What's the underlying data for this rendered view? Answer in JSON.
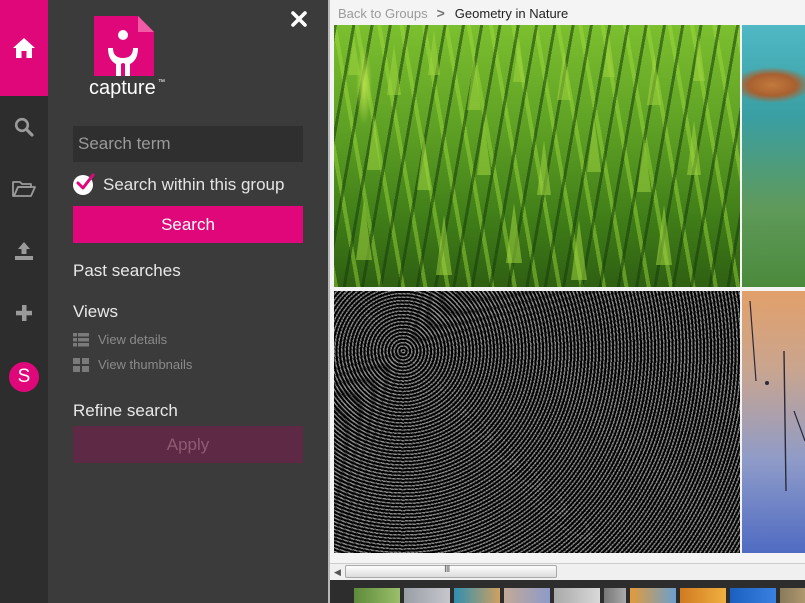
{
  "sidebar_rail": {
    "items": [
      {
        "icon": "home-icon",
        "active": true
      },
      {
        "icon": "search-icon"
      },
      {
        "icon": "folder-open-icon"
      },
      {
        "icon": "upload-icon"
      },
      {
        "icon": "plus-icon"
      }
    ],
    "avatar_initial": "S",
    "accent_color": "#e0077a"
  },
  "panel": {
    "logo_text": "capture",
    "logo_mark": "™",
    "search": {
      "placeholder": "Search term",
      "value": ""
    },
    "search_within_group": {
      "label": "Search within this group",
      "checked": true
    },
    "search_button": "Search",
    "past_searches_title": "Past searches",
    "views_title": "Views",
    "view_options": [
      {
        "label": "View details",
        "icon": "list-icon"
      },
      {
        "label": "View thumbnails",
        "icon": "grid-icon"
      }
    ],
    "refine_title": "Refine search",
    "apply_button": "Apply"
  },
  "main": {
    "breadcrumb": {
      "back_label": "Back to Groups",
      "separator": ">",
      "current": "Geometry in Nature"
    },
    "photos": [
      {
        "name": "conifer-forest-aerial"
      },
      {
        "name": "turquoise-lake"
      },
      {
        "name": "black-white-pattern"
      },
      {
        "name": "sunset-reeds"
      }
    ],
    "scrollbar_grip": "III"
  }
}
